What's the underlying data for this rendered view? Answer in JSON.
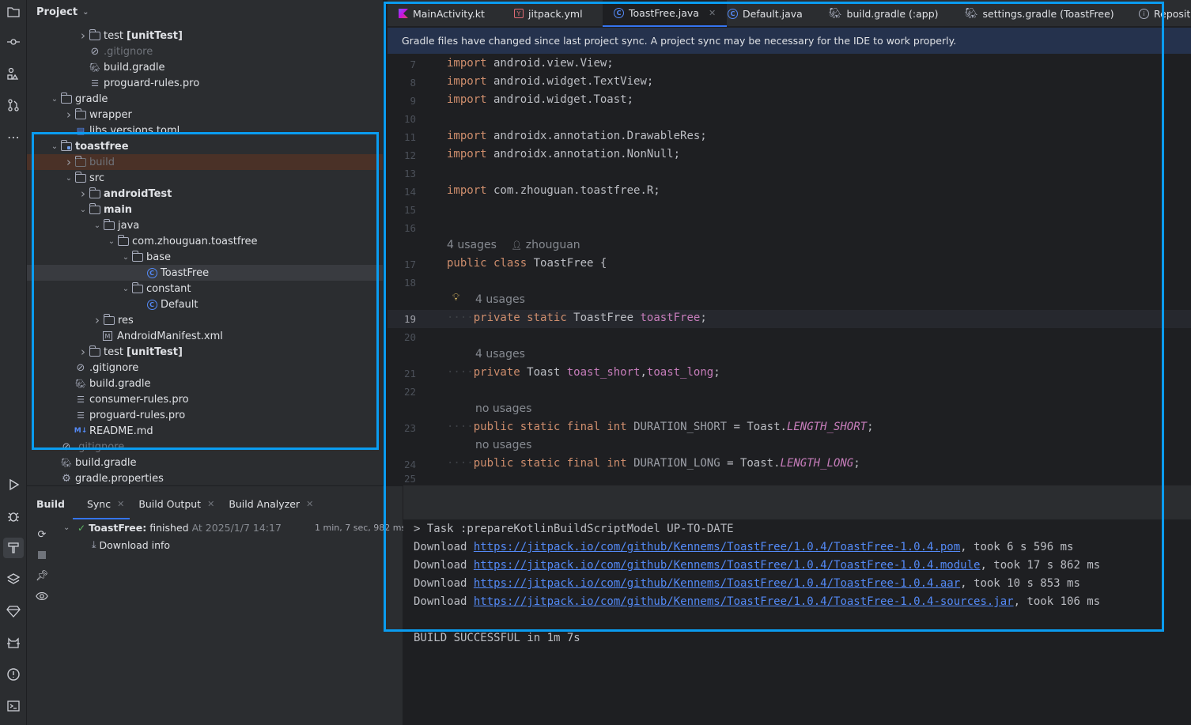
{
  "project_panel": {
    "title": "Project",
    "tree": [
      {
        "label": "test",
        "suffix": "[unitTest]",
        "kind": "folder"
      },
      {
        "label": ".gitignore",
        "kind": "ignore",
        "dim": true
      },
      {
        "label": "build.gradle",
        "kind": "gradle"
      },
      {
        "label": "proguard-rules.pro",
        "kind": "text"
      },
      {
        "label": "gradle",
        "kind": "folder"
      },
      {
        "label": "wrapper",
        "kind": "folder"
      },
      {
        "label": "libs.versions.toml",
        "kind": "toml"
      },
      {
        "label": "toastfree",
        "kind": "module"
      },
      {
        "label": "build",
        "kind": "folder",
        "dim": true
      },
      {
        "label": "src",
        "kind": "folder"
      },
      {
        "label": "androidTest",
        "kind": "folder"
      },
      {
        "label": "main",
        "kind": "folder"
      },
      {
        "label": "java",
        "kind": "folder"
      },
      {
        "label": "com.zhouguan.toastfree",
        "kind": "package"
      },
      {
        "label": "base",
        "kind": "package"
      },
      {
        "label": "ToastFree",
        "kind": "class"
      },
      {
        "label": "constant",
        "kind": "package"
      },
      {
        "label": "Default",
        "kind": "class"
      },
      {
        "label": "res",
        "kind": "folder"
      },
      {
        "label": "AndroidManifest.xml",
        "kind": "manifest"
      },
      {
        "label": "test",
        "suffix": "[unitTest]",
        "kind": "folder"
      },
      {
        "label": ".gitignore",
        "kind": "ignore"
      },
      {
        "label": "build.gradle",
        "kind": "gradle"
      },
      {
        "label": "consumer-rules.pro",
        "kind": "text"
      },
      {
        "label": "proguard-rules.pro",
        "kind": "text"
      },
      {
        "label": "README.md",
        "kind": "md"
      },
      {
        "label": ".gitignore",
        "kind": "ignore",
        "dim": true
      },
      {
        "label": "build.gradle",
        "kind": "gradle"
      },
      {
        "label": "gradle.properties",
        "kind": "settings"
      }
    ]
  },
  "editor_tabs": [
    {
      "label": "MainActivity.kt",
      "icon": "kotlin-icon"
    },
    {
      "label": "jitpack.yml",
      "icon": "yaml-icon"
    },
    {
      "label": "ToastFree.java",
      "icon": "class-icon",
      "active": true
    },
    {
      "label": "Default.java",
      "icon": "class-icon"
    },
    {
      "label": "build.gradle (:app)",
      "icon": "gradle-icon"
    },
    {
      "label": "settings.gradle (ToastFree)",
      "icon": "gradle-icon"
    },
    {
      "label": "Reposit",
      "icon": "info-icon"
    }
  ],
  "notification": "Gradle files have changed since last project sync. A project sync may be necessary for the IDE to work properly.",
  "gutter_lines": [
    "7",
    "8",
    "9",
    "10",
    "11",
    "12",
    "13",
    "14",
    "15",
    "16",
    "17",
    "18",
    "19",
    "20",
    "21",
    "22",
    "23",
    "24",
    "25"
  ],
  "code": {
    "l7": [
      "import",
      " android.view.View;"
    ],
    "l8": [
      "import",
      " android.widget.TextView;"
    ],
    "l9": [
      "import",
      " android.widget.Toast;"
    ],
    "l11": [
      "import",
      " androidx.annotation.DrawableRes;"
    ],
    "l12": [
      "import",
      " androidx.annotation.NonNull;"
    ],
    "l14": [
      "import",
      " com.zhouguan.toastfree.R;"
    ],
    "hint_class": "4 usages",
    "hint_author": "zhouguan",
    "l17": [
      "public",
      " ",
      "class",
      " ToastFree {"
    ],
    "hint_19": "4 usages",
    "l19": [
      "private",
      " ",
      "static",
      " ToastFree ",
      "toastFree",
      ";"
    ],
    "hint_21": "4 usages",
    "l21": [
      "private",
      " Toast ",
      "toast_short",
      ",",
      "toast_long",
      ";"
    ],
    "hint_23": "no usages",
    "l23": [
      "public",
      " ",
      "static",
      " ",
      "final",
      " ",
      "int",
      " ",
      "DURATION_SHORT",
      " = Toast.",
      "LENGTH_SHORT",
      ";"
    ],
    "hint_24": "no usages",
    "l24": [
      "public",
      " ",
      "static",
      " ",
      "final",
      " ",
      "int",
      " ",
      "DURATION_LONG",
      " = Toast.",
      "LENGTH_LONG",
      ";"
    ]
  },
  "build_panel": {
    "title": "Build",
    "tabs": [
      "Sync",
      "Build Output",
      "Build Analyzer"
    ],
    "status_name": "ToastFree:",
    "status_text": "finished",
    "status_time": "At 2025/1/7 14:17",
    "duration": "1 min, 7 sec, 982 ms",
    "child": "Download info"
  },
  "console": {
    "task_line": "> Task :prepareKotlinBuildScriptModel UP-TO-DATE",
    "downloads": [
      {
        "prefix": "Download ",
        "url": "https://jitpack.io/com/github/Kennems/ToastFree/1.0.4/ToastFree-1.0.4.pom",
        "suffix": ", took 6 s 596 ms"
      },
      {
        "prefix": "Download ",
        "url": "https://jitpack.io/com/github/Kennems/ToastFree/1.0.4/ToastFree-1.0.4.module",
        "suffix": ", took 17 s 862 ms"
      },
      {
        "prefix": "Download ",
        "url": "https://jitpack.io/com/github/Kennems/ToastFree/1.0.4/ToastFree-1.0.4.aar",
        "suffix": ", took 10 s 853 ms"
      },
      {
        "prefix": "Download ",
        "url": "https://jitpack.io/com/github/Kennems/ToastFree/1.0.4/ToastFree-1.0.4-sources.jar",
        "suffix": ", took 106 ms"
      }
    ],
    "result": "BUILD SUCCESSFUL in 1m 7s"
  },
  "colors": {
    "highlight": "#0a9cf0",
    "accent": "#3574f0",
    "keyword": "#cf8e6d",
    "field": "#c77dbb",
    "link": "#548af7"
  }
}
